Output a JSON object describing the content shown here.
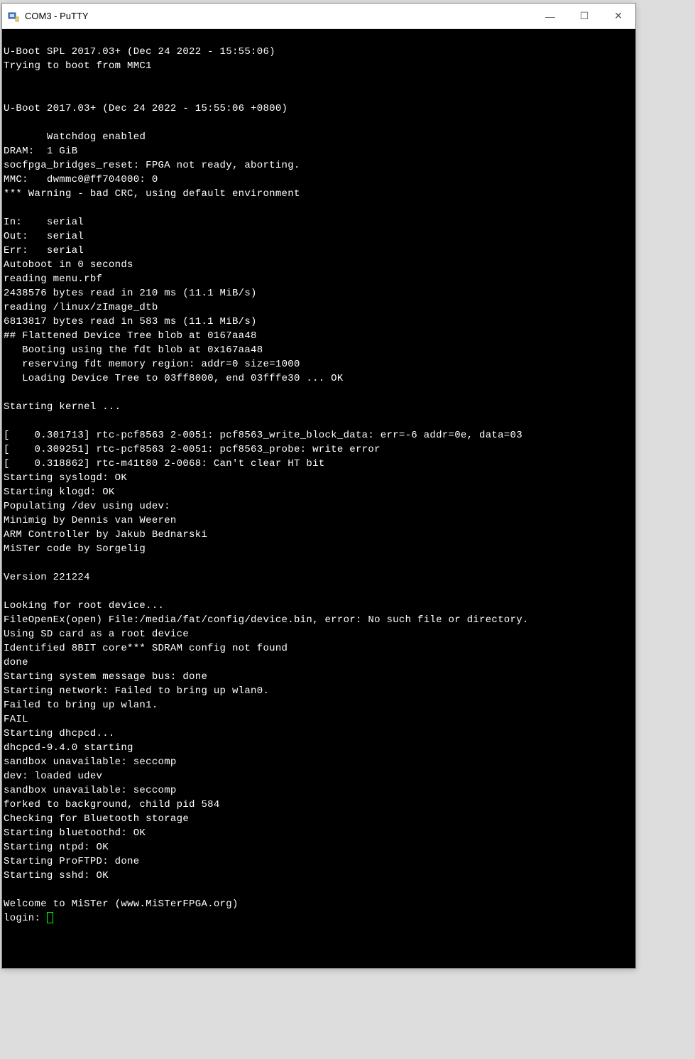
{
  "titlebar": {
    "title": "COM3 - PuTTY",
    "minimize": "—",
    "maximize": "☐",
    "close": "✕"
  },
  "terminal": {
    "lines": [
      "",
      "U-Boot SPL 2017.03+ (Dec 24 2022 - 15:55:06)",
      "Trying to boot from MMC1",
      "",
      "",
      "U-Boot 2017.03+ (Dec 24 2022 - 15:55:06 +0800)",
      "",
      "       Watchdog enabled",
      "DRAM:  1 GiB",
      "socfpga_bridges_reset: FPGA not ready, aborting.",
      "MMC:   dwmmc0@ff704000: 0",
      "*** Warning - bad CRC, using default environment",
      "",
      "In:    serial",
      "Out:   serial",
      "Err:   serial",
      "Autoboot in 0 seconds",
      "reading menu.rbf",
      "2438576 bytes read in 210 ms (11.1 MiB/s)",
      "reading /linux/zImage_dtb",
      "6813817 bytes read in 583 ms (11.1 MiB/s)",
      "## Flattened Device Tree blob at 0167aa48",
      "   Booting using the fdt blob at 0x167aa48",
      "   reserving fdt memory region: addr=0 size=1000",
      "   Loading Device Tree to 03ff8000, end 03fffe30 ... OK",
      "",
      "Starting kernel ...",
      "",
      "[    0.301713] rtc-pcf8563 2-0051: pcf8563_write_block_data: err=-6 addr=0e, data=03",
      "[    0.309251] rtc-pcf8563 2-0051: pcf8563_probe: write error",
      "[    0.318862] rtc-m41t80 2-0068: Can't clear HT bit",
      "Starting syslogd: OK",
      "Starting klogd: OK",
      "Populating /dev using udev:",
      "Minimig by Dennis van Weeren",
      "ARM Controller by Jakub Bednarski",
      "MiSTer code by Sorgelig",
      "",
      "Version 221224",
      "",
      "Looking for root device...",
      "FileOpenEx(open) File:/media/fat/config/device.bin, error: No such file or directory.",
      "Using SD card as a root device",
      "Identified 8BIT core*** SDRAM config not found",
      "done",
      "Starting system message bus: done",
      "Starting network: Failed to bring up wlan0.",
      "Failed to bring up wlan1.",
      "FAIL",
      "Starting dhcpcd...",
      "dhcpcd-9.4.0 starting",
      "sandbox unavailable: seccomp",
      "dev: loaded udev",
      "sandbox unavailable: seccomp",
      "forked to background, child pid 584",
      "Checking for Bluetooth storage",
      "Starting bluetoothd: OK",
      "Starting ntpd: OK",
      "Starting ProFTPD: done",
      "Starting sshd: OK",
      "",
      "Welcome to MiSTer (www.MiSTerFPGA.org)"
    ],
    "prompt": "login: "
  }
}
